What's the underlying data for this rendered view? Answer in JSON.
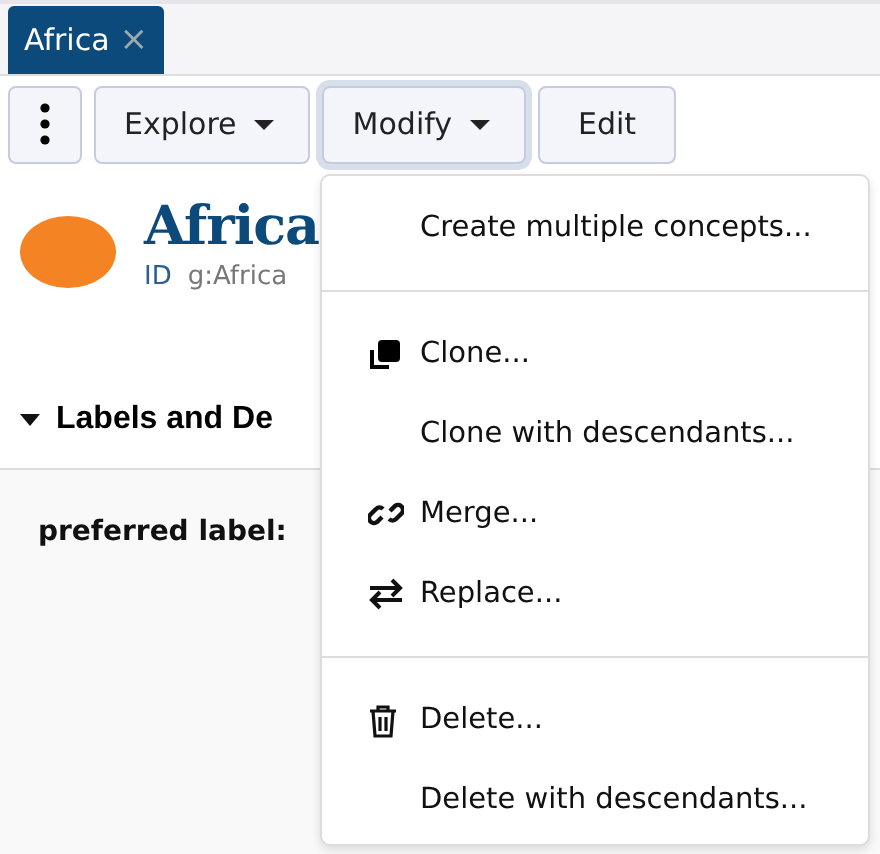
{
  "tabs": [
    {
      "label": "Africa",
      "close": "×",
      "selected": true
    }
  ],
  "toolbar": {
    "buttons": [
      {
        "kind": "more"
      },
      {
        "kind": "dropdown",
        "label": "Explore",
        "open": false
      },
      {
        "kind": "dropdown",
        "label": "Modify",
        "open": true
      },
      {
        "kind": "plain",
        "label": "Edit",
        "open": false
      }
    ]
  },
  "concept": {
    "title": "Africa",
    "id_label": "ID",
    "id_value": "g:Africa"
  },
  "section": {
    "title": "Labels and De",
    "expanded": true,
    "fields": [
      {
        "label": "preferred label:"
      }
    ]
  },
  "menu": {
    "groups": [
      [
        {
          "label": "Create multiple concepts...",
          "kind": "plain"
        }
      ],
      [
        {
          "label": "Clone...",
          "kind": "clone"
        },
        {
          "label": "Clone with descendants...",
          "kind": "plain"
        },
        {
          "label": "Merge...",
          "kind": "merge"
        },
        {
          "label": "Replace...",
          "kind": "replace"
        }
      ],
      [
        {
          "label": "Delete...",
          "kind": "delete"
        },
        {
          "label": "Delete with descendants...",
          "kind": "plain"
        }
      ]
    ]
  }
}
